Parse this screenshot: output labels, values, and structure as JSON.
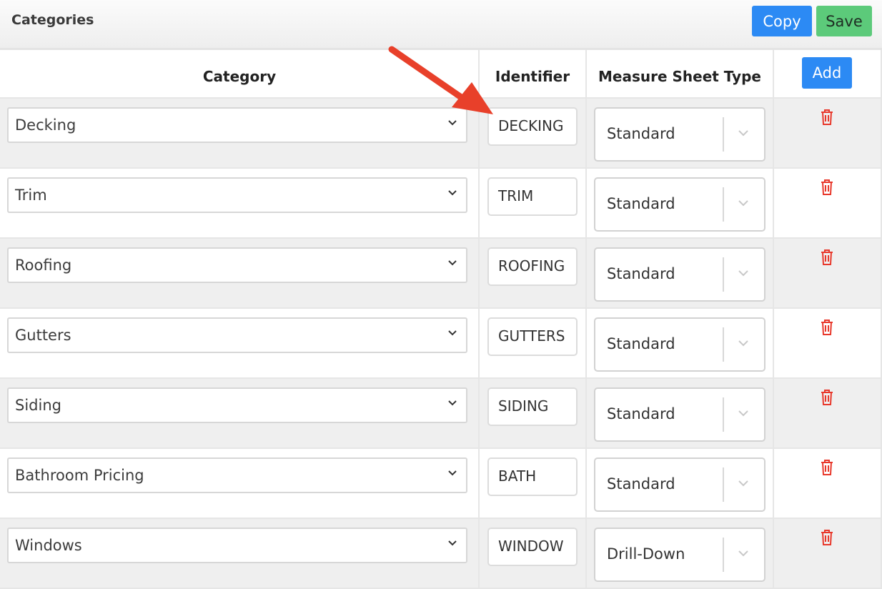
{
  "header": {
    "title": "Categories",
    "copy_label": "Copy",
    "save_label": "Save"
  },
  "table": {
    "columns": [
      "Category",
      "Identifier",
      "Measure Sheet Type"
    ],
    "add_label": "Add",
    "rows": [
      {
        "category": "Decking",
        "identifier": "DECKING",
        "measure_sheet_type": "Standard"
      },
      {
        "category": "Trim",
        "identifier": "TRIM",
        "measure_sheet_type": "Standard"
      },
      {
        "category": "Roofing",
        "identifier": "ROOFING",
        "measure_sheet_type": "Standard"
      },
      {
        "category": "Gutters",
        "identifier": "GUTTERS",
        "measure_sheet_type": "Standard"
      },
      {
        "category": "Siding",
        "identifier": "SIDING",
        "measure_sheet_type": "Standard"
      },
      {
        "category": "Bathroom Pricing",
        "identifier": "BATH",
        "measure_sheet_type": "Standard"
      },
      {
        "category": "Windows",
        "identifier": "WINDOW",
        "measure_sheet_type": "Drill-Down"
      }
    ]
  },
  "colors": {
    "primary_button": "#2c8af4",
    "save_button": "#5cca7a",
    "delete_icon": "#e8382b",
    "annotation_arrow": "#e8402a"
  },
  "icons": {
    "delete": "trash-icon",
    "dropdown": "chevron-down-icon"
  }
}
